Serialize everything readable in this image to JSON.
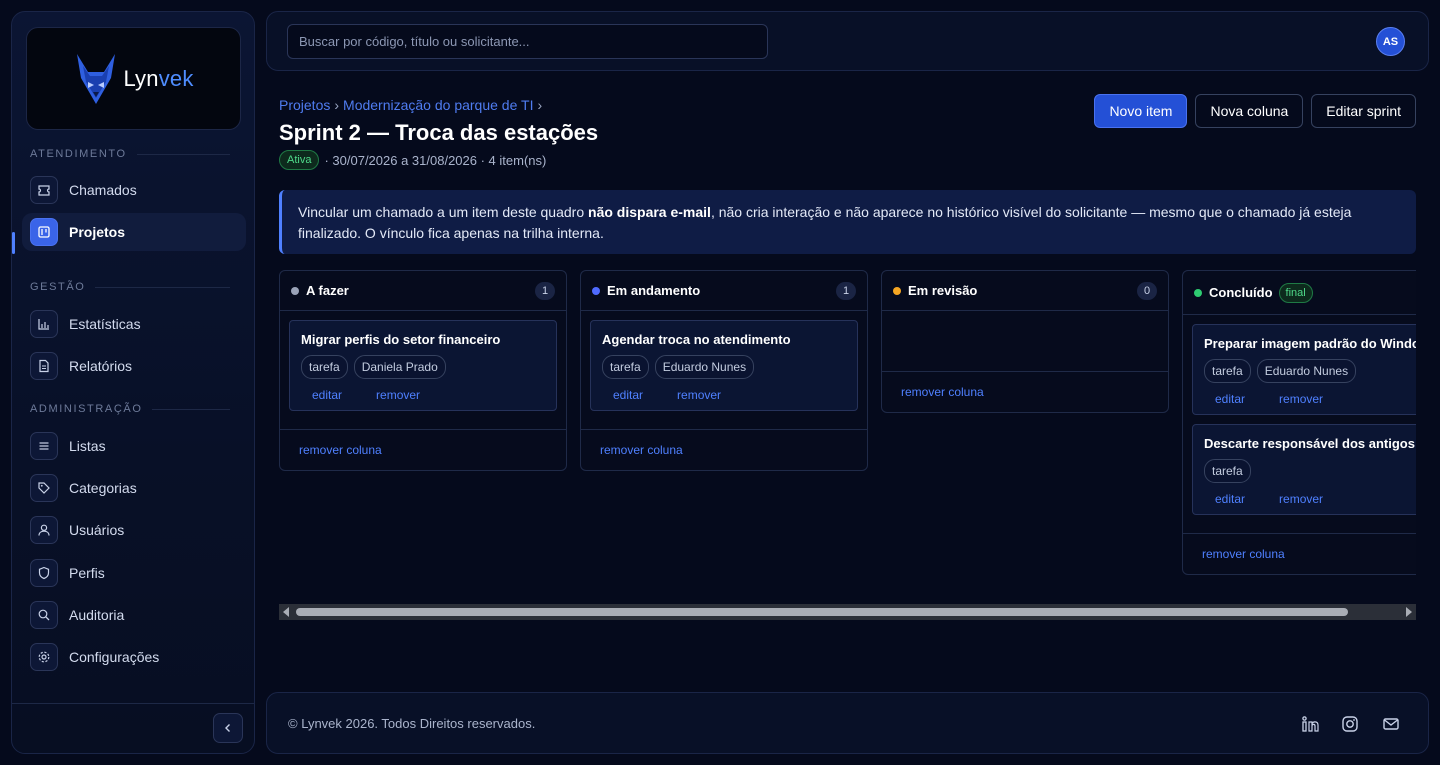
{
  "brand": {
    "name_main": "Lyn",
    "name_accent": "vek"
  },
  "sidebar": {
    "sections": [
      "ATENDIMENTO",
      "GESTÃO",
      "ADMINISTRAÇÃO"
    ],
    "items": [
      {
        "label": "Chamados",
        "icon": "ticket-icon"
      },
      {
        "label": "Projetos",
        "icon": "kanban-icon",
        "active": true
      },
      {
        "label": "Estatísticas",
        "icon": "bar-chart-icon"
      },
      {
        "label": "Relatórios",
        "icon": "document-icon"
      },
      {
        "label": "Listas",
        "icon": "list-icon"
      },
      {
        "label": "Categorias",
        "icon": "tag-icon"
      },
      {
        "label": "Usuários",
        "icon": "user-icon"
      },
      {
        "label": "Perfis",
        "icon": "shield-icon"
      },
      {
        "label": "Auditoria",
        "icon": "search-icon"
      },
      {
        "label": "Configurações",
        "icon": "gear-icon"
      }
    ]
  },
  "topbar": {
    "search_placeholder": "Buscar por código, título ou solicitante...",
    "avatar_initials": "AS"
  },
  "header": {
    "breadcrumb": [
      "Projetos",
      "Modernização do parque de TI"
    ],
    "breadcrumb_sep": "›",
    "title": "Sprint 2 — Troca das estações",
    "status": "Ativa",
    "meta": "· 30/07/2026 a 31/08/2026 · 4 item(ns)",
    "actions": {
      "new_item": "Novo item",
      "new_column": "Nova coluna",
      "edit_sprint": "Editar sprint"
    }
  },
  "notice": {
    "before": "Vincular um chamado a um item deste quadro ",
    "bold": "não dispara e-mail",
    "after": ", não cria interação e não aparece no histórico visível do solicitante — mesmo que o chamado já esteja finalizado. O vínculo fica apenas na trilha interna."
  },
  "board": {
    "edit_label": "editar",
    "remove_label": "remover",
    "remove_column_label": "remover coluna",
    "final_badge": "final",
    "columns": [
      {
        "title": "A fazer",
        "color": "#9aa3b8",
        "count": "1",
        "cards": [
          {
            "title": "Migrar perfis do setor financeiro",
            "tags": [
              "tarefa",
              "Daniela Prado"
            ]
          }
        ]
      },
      {
        "title": "Em andamento",
        "color": "#4f6bff",
        "count": "1",
        "cards": [
          {
            "title": "Agendar troca no atendimento",
            "tags": [
              "tarefa",
              "Eduardo Nunes"
            ]
          }
        ]
      },
      {
        "title": "Em revisão",
        "color": "#f5a623",
        "count": "0",
        "cards": []
      },
      {
        "title": "Concluído",
        "color": "#2ecc71",
        "final": true,
        "cards": [
          {
            "title": "Preparar imagem padrão do Windows",
            "tags": [
              "tarefa",
              "Eduardo Nunes"
            ]
          },
          {
            "title": "Descarte responsável dos antigos",
            "tags": [
              "tarefa"
            ]
          }
        ]
      }
    ]
  },
  "footer": {
    "text": "© Lynvek 2026. Todos Direitos reservados."
  },
  "social": [
    "linkedin-icon",
    "instagram-icon",
    "mail-icon"
  ]
}
